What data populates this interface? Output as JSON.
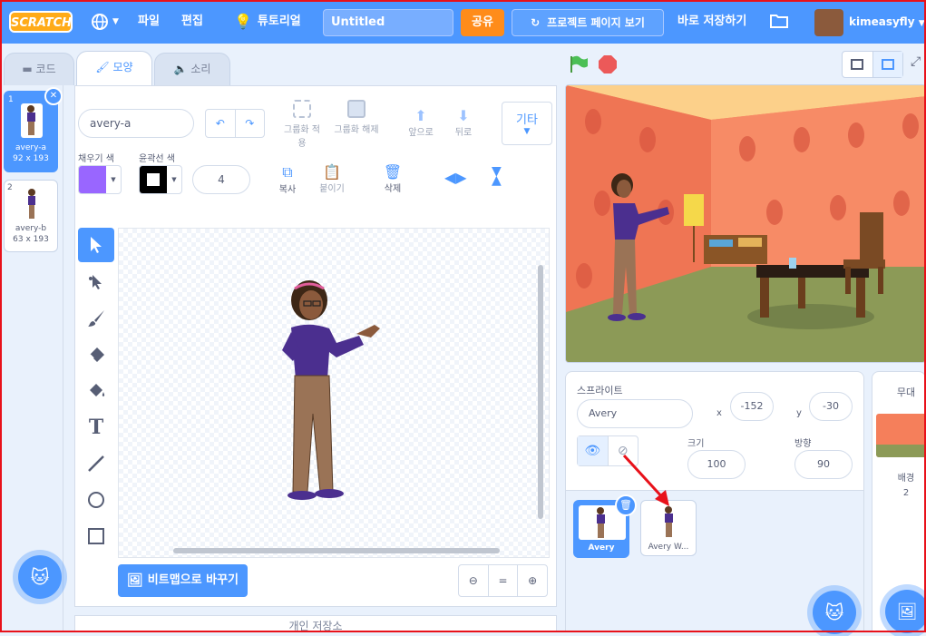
{
  "menubar": {
    "logo": "SCRATCH",
    "file": "파일",
    "edit": "편집",
    "tutorials": "튜토리얼",
    "project_title": "Untitled",
    "share": "공유",
    "see_project_page": "프로젝트 페이지 보기",
    "save_now": "바로 저장하기",
    "username": "kimeasyfly"
  },
  "tabs": {
    "code": "코드",
    "costumes": "모양",
    "sounds": "소리"
  },
  "costumes": [
    {
      "num": "1",
      "name": "avery-a",
      "size": "92 x 193"
    },
    {
      "num": "2",
      "name": "avery-b",
      "size": "63 x 193"
    }
  ],
  "editor": {
    "costume_name": "avery-a",
    "group": "그룹화 적용",
    "ungroup": "그룹화 해제",
    "forward": "앞으로",
    "backward": "뒤로",
    "more": "기타",
    "fill_label": "채우기 색",
    "outline_label": "윤곽선 색",
    "outline_width": "4",
    "copy": "복사",
    "paste": "붙이기",
    "delete": "삭제",
    "convert_bitmap": "비트맵으로 바꾸기",
    "fill_color": "#9966ff",
    "outline_color": "#000000"
  },
  "sprite_panel": {
    "sprite_label": "스프라이트",
    "sprite_name": "Avery",
    "x_label": "x",
    "x_value": "-152",
    "y_label": "y",
    "y_value": "-30",
    "show_label": "보기",
    "size_label": "크기",
    "size_value": "100",
    "direction_label": "방향",
    "direction_value": "90",
    "sprites": [
      {
        "name": "Avery"
      },
      {
        "name": "Avery W..."
      }
    ]
  },
  "stage_panel": {
    "title": "무대",
    "backdrops_label": "배경",
    "backdrops_count": "2"
  },
  "bottom": {
    "backpack": "개인 저장소"
  }
}
